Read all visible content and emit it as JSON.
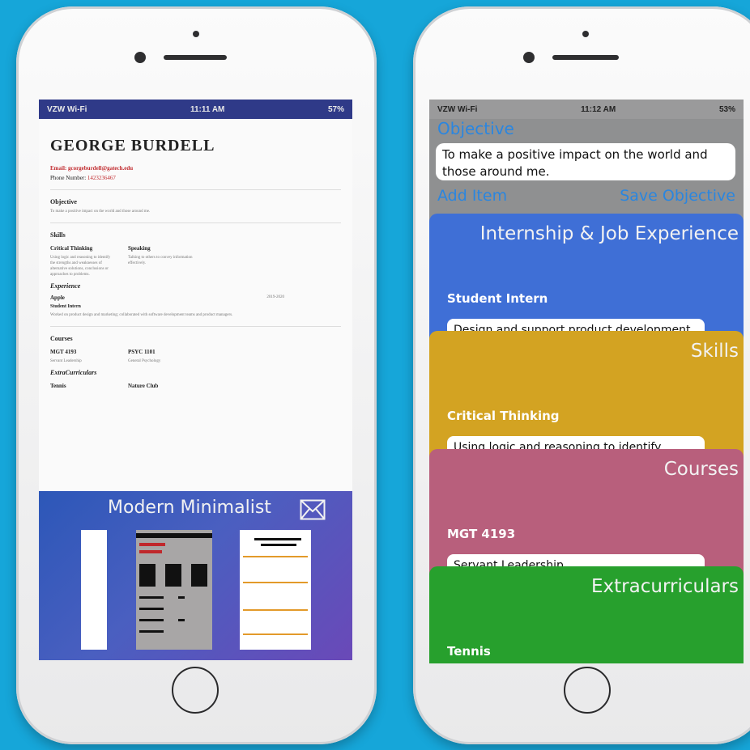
{
  "left_phone": {
    "status": {
      "carrier": "VZW Wi-Fi",
      "time": "11:11 AM",
      "battery": "57%"
    },
    "resume": {
      "name": "GEORGE BURDELL",
      "email": "Email: gcorgeburdell@gatech.edu",
      "phone_label": "Phone Number:",
      "phone_value": "1423236467",
      "objective_heading": "Objective",
      "objective_text": "To make a positive impact on the world and those around me.",
      "skills_heading": "Skills",
      "skills": [
        {
          "title": "Critical Thinking",
          "desc": "Using logic and reasoning to identify the strengths and weaknesses of alternative solutions, conclusions or approaches to problems."
        },
        {
          "title": "Speaking",
          "desc": "Talking to others to convey information effectively."
        }
      ],
      "experience_heading": "Experience",
      "experience_company": "Apple",
      "experience_dates": "2019-2020",
      "experience_role": "Student Intern",
      "experience_desc": "Worked on product design and marketing; collaborated with software development teams and product managers.",
      "courses_heading": "Courses",
      "courses": [
        {
          "title": "MGT 4193",
          "desc": "Servant Leadership"
        },
        {
          "title": "PSYC 1101",
          "desc": "General Psychology"
        }
      ],
      "extracurriculars_heading": "ExtraCurriculars",
      "extracurriculars": [
        "Tennis",
        "Nature Club"
      ]
    },
    "theme": {
      "title": "Modern Minimalist",
      "mail_icon": "mail-icon"
    }
  },
  "right_phone": {
    "status": {
      "carrier": "VZW Wi-Fi",
      "time": "11:12 AM",
      "battery": "53%"
    },
    "objective_label": "Objective",
    "objective_text": "To make a positive impact on the world and those around me.",
    "add_item": "Add Item",
    "save_objective": "Save Objective",
    "cards": [
      {
        "title": "Internship & Job Experience",
        "item": "Student Intern",
        "text": "Design and support product development",
        "color": "#3f6fd6"
      },
      {
        "title": "Skills",
        "item": "Critical Thinking",
        "text": "Using logic and reasoning to identify",
        "color": "#d3a322"
      },
      {
        "title": "Courses",
        "item": "MGT 4193",
        "text": "Servant Leadership",
        "color": "#b85f7c"
      },
      {
        "title": "Extracurriculars",
        "item": "Tennis",
        "text": "",
        "color": "#27a02d"
      }
    ]
  }
}
